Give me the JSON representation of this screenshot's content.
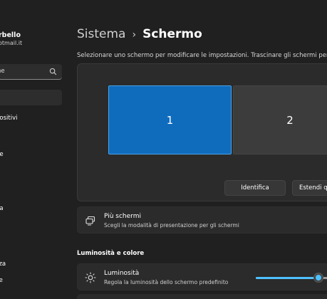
{
  "account": {
    "name": "rbello",
    "email": "otmail.it"
  },
  "search": {
    "text": "ne"
  },
  "sidebar": {
    "items": [
      {
        "label": ""
      },
      {
        "label": "positivi"
      },
      {
        "label": "ne"
      },
      {
        "label": "ua"
      },
      {
        "label": "zza"
      },
      {
        "label": "ce"
      }
    ]
  },
  "header": {
    "parent": "Sistema",
    "separator": "›",
    "current": "Schermo"
  },
  "description": "Selezionare uno schermo per modificare le impostazioni. Trascinare gli schermi per riorgan",
  "arrange": {
    "monitors": [
      {
        "label": "1"
      },
      {
        "label": "2"
      }
    ],
    "identify_label": "Identifica",
    "extend_label": "Estendi qu"
  },
  "multi_display": {
    "title": "Più schermi",
    "subtitle": "Scegli la modalità di presentazione per gli schermi"
  },
  "brightness_section": {
    "title": "Luminosità e colore"
  },
  "brightness": {
    "title": "Luminosità",
    "subtitle": "Regola la luminosità dello schermo predefinito",
    "value_percent": 73
  },
  "colors": {
    "accent": "#4cc2ff",
    "selected_monitor": "#0f6cbd",
    "background": "#202020",
    "card": "#2b2b2b"
  }
}
